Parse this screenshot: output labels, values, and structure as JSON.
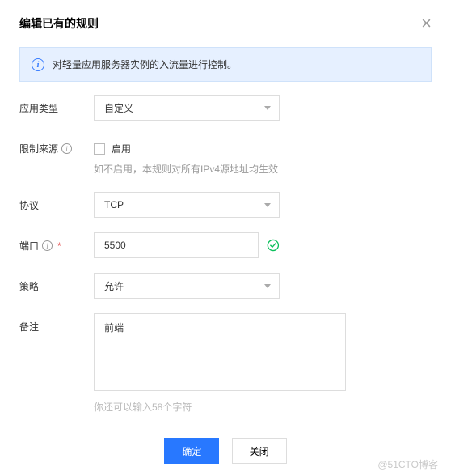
{
  "dialog": {
    "title": "编辑已有的规则",
    "info": "对轻量应用服务器实例的入流量进行控制。"
  },
  "form": {
    "appType": {
      "label": "应用类型",
      "value": "自定义"
    },
    "restrict": {
      "label": "限制来源",
      "checkbox": "启用",
      "hint": "如不启用，本规则对所有IPv4源地址均生效"
    },
    "protocol": {
      "label": "协议",
      "value": "TCP"
    },
    "port": {
      "label": "端口",
      "value": "5500"
    },
    "policy": {
      "label": "策略",
      "value": "允许"
    },
    "remark": {
      "label": "备注",
      "value": "前端",
      "charHint": "你还可以输入58个字符"
    }
  },
  "footer": {
    "ok": "确定",
    "close": "关闭"
  },
  "watermark": "@51CTO博客"
}
